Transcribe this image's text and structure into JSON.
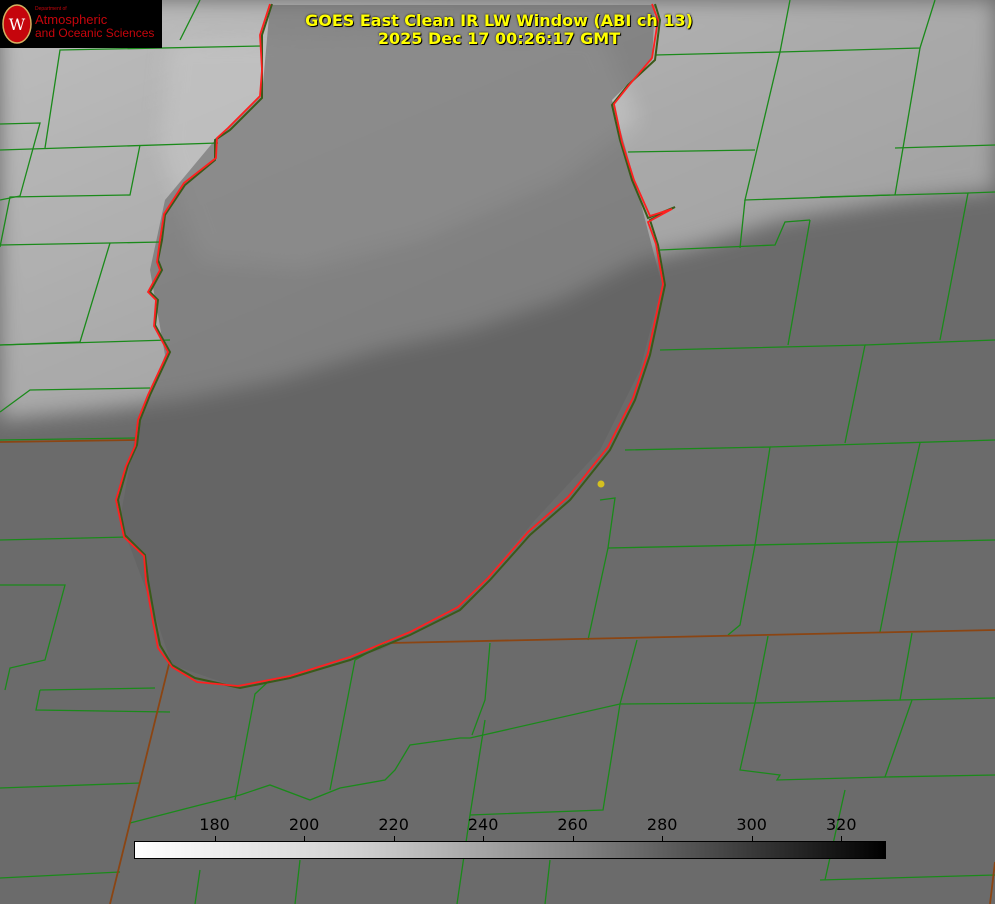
{
  "title_line1": "GOES East Clean IR LW Window (ABI ch 13)",
  "title_line2": "2025 Dec 17 00:26:17 GMT",
  "logo": {
    "department": "Department of",
    "line1": "Atmospheric",
    "line2": "and Oceanic Sciences",
    "seal_letter": "W"
  },
  "colorbar": {
    "ticks": [
      "180",
      "200",
      "220",
      "240",
      "260",
      "280",
      "300",
      "320"
    ],
    "tick_values": [
      180,
      200,
      220,
      240,
      260,
      280,
      300,
      320
    ],
    "range": [
      162,
      330
    ]
  },
  "colors": {
    "title": "#ffff00",
    "county_lines": "#1a8a1a",
    "lake_outline": "#ff2020",
    "state_lines": "#8b4513",
    "site_marker": "#d4c020"
  }
}
